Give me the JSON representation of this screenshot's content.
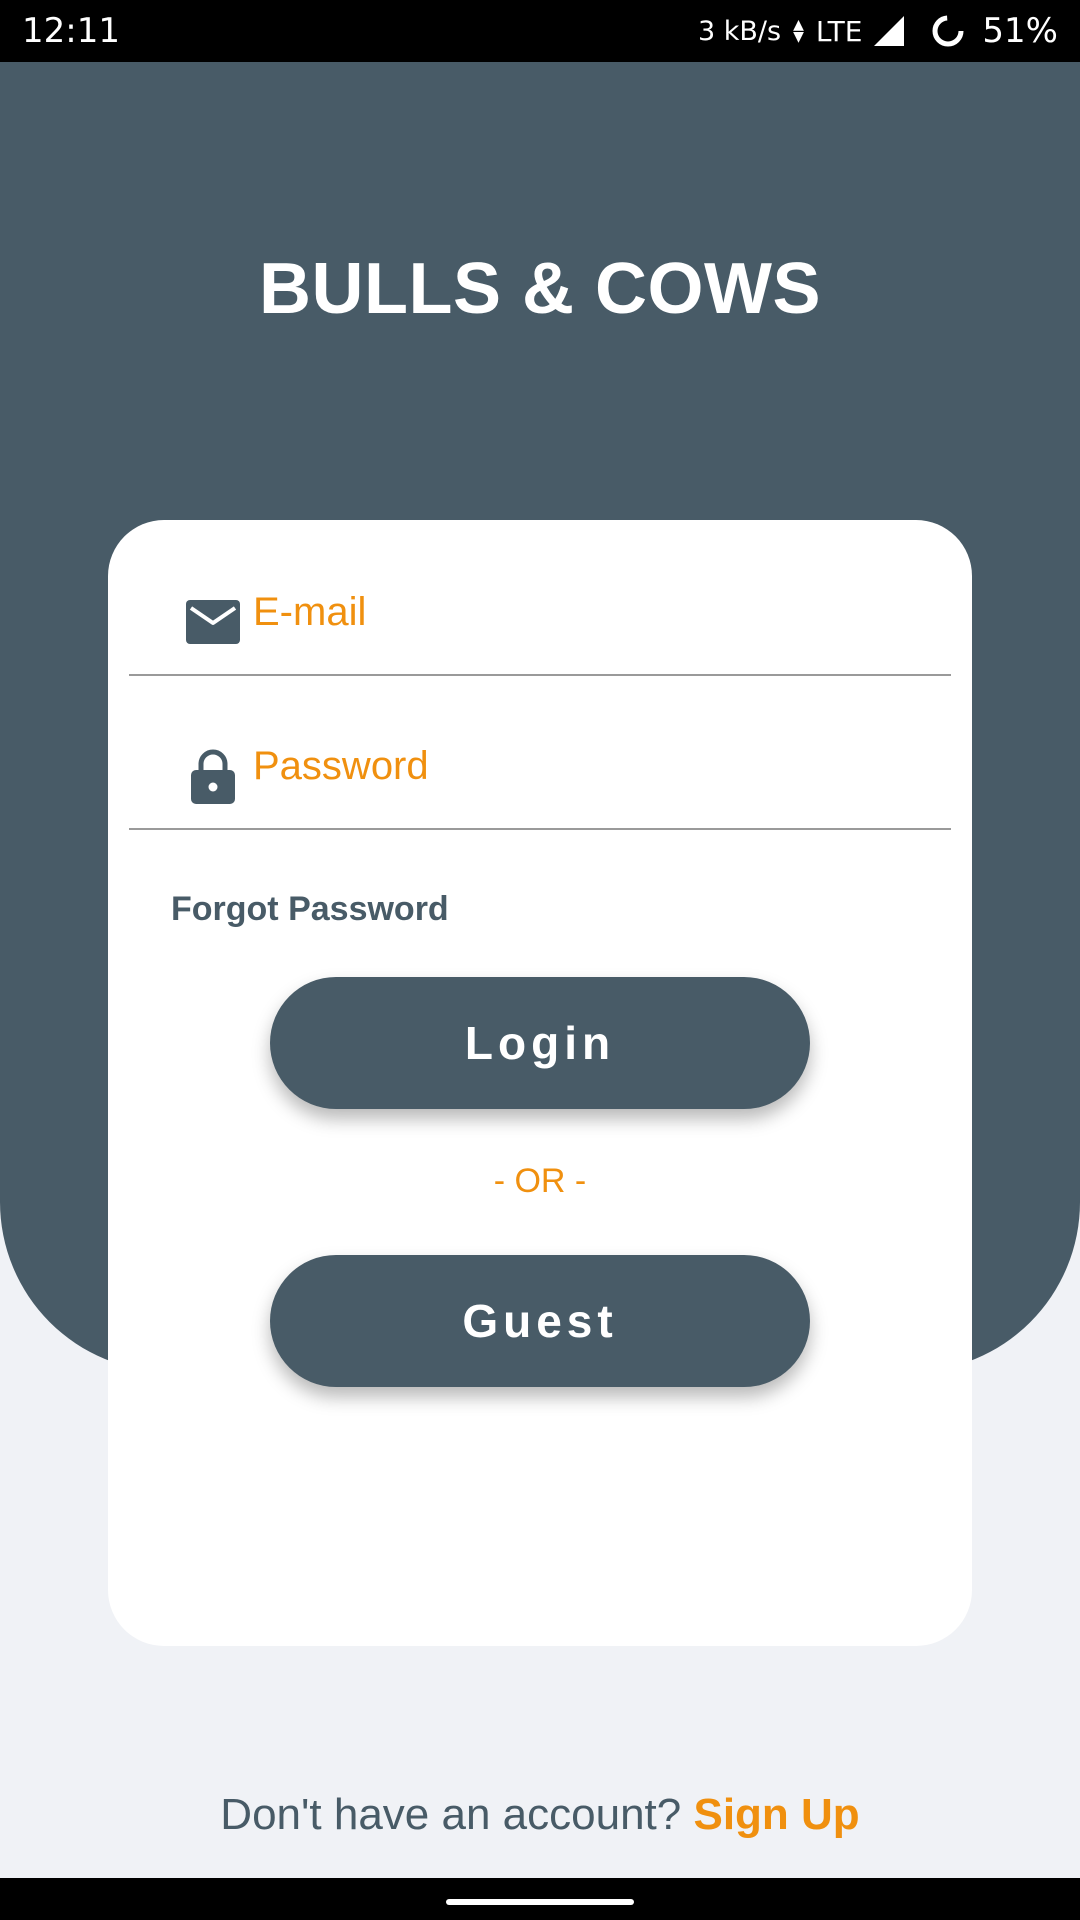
{
  "status_bar": {
    "time": "12:11",
    "speed": "3 kB/s",
    "network": "LTE",
    "battery": "51%"
  },
  "app": {
    "title": "BULLS & COWS"
  },
  "form": {
    "email_placeholder": "E-mail",
    "email_value": "",
    "password_placeholder": "Password",
    "password_value": "",
    "forgot_label": "Forgot Password",
    "login_label": "Login",
    "or_label": "- OR -",
    "guest_label": "Guest"
  },
  "footer": {
    "prompt": "Don't have an account?",
    "signup_label": "Sign Up"
  },
  "icons": {
    "email": "mail-icon",
    "password": "lock-icon"
  },
  "colors": {
    "primary": "#485b67",
    "accent": "#f0900f",
    "background": "#f0f2f6",
    "card": "#ffffff"
  }
}
